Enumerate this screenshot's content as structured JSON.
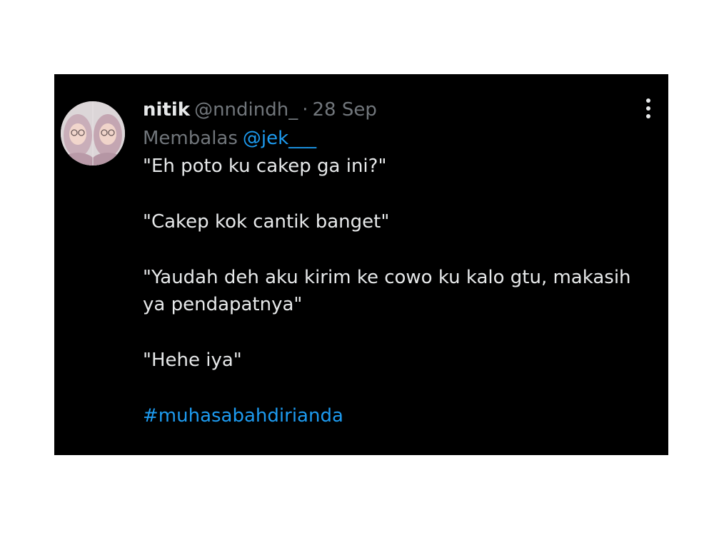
{
  "tweet": {
    "author_name": "nitik",
    "author_handle": "@nndindh_",
    "separator": "·",
    "date": "28 Sep",
    "reply_prefix": "Membalas",
    "reply_to": "@jek___",
    "paragraphs": [
      "\"Eh poto ku cakep ga ini?\"",
      "\"Cakep kok cantik banget\"",
      "\"Yaudah deh aku kirim ke cowo ku kalo gtu, makasih ya pendapatnya\"",
      "\"Hehe iya\""
    ],
    "hashtag": "#muhasabahdirianda",
    "avatar_icon": "profile-photo",
    "more_icon": "more-vertical-icon"
  },
  "colors": {
    "background": "#000000",
    "primary_text": "#e7e9ea",
    "secondary_text": "#71767b",
    "accent": "#1d9bf0"
  }
}
